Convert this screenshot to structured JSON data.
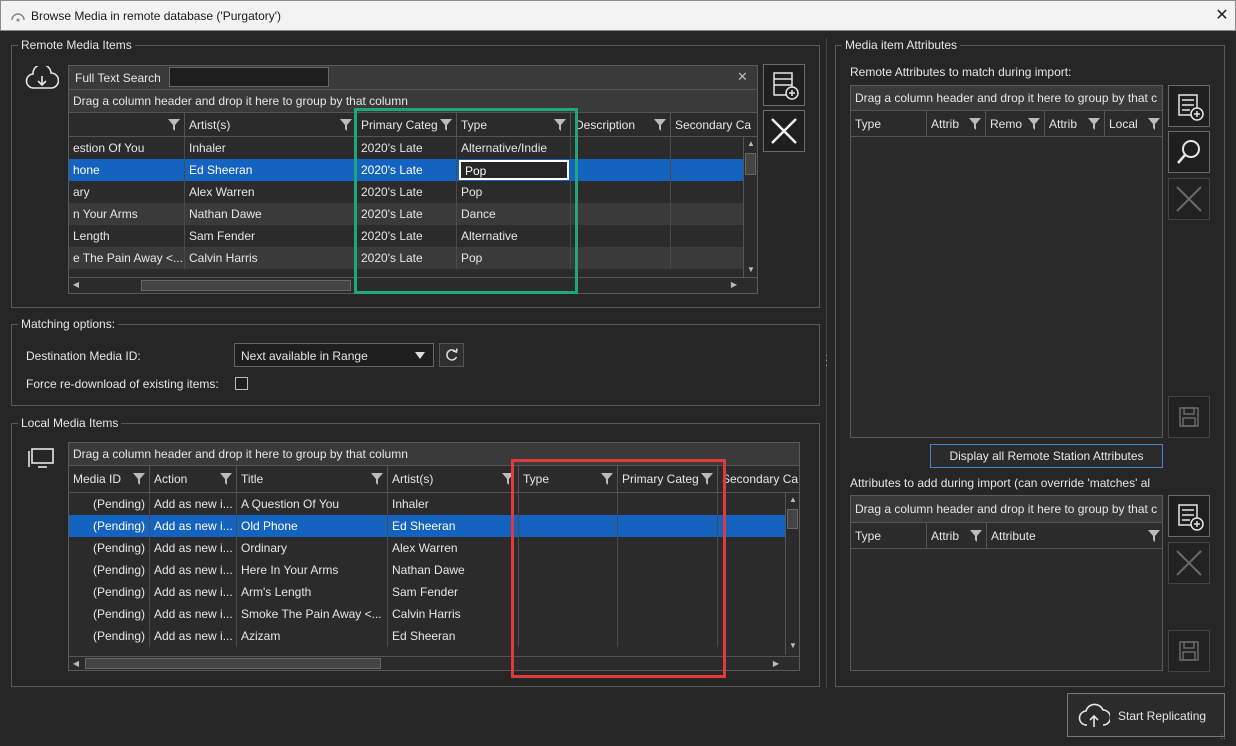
{
  "window": {
    "title": "Browse Media in remote database ('Purgatory')",
    "close_glyph": "✕"
  },
  "remote": {
    "group_label": "Remote Media Items",
    "search_label": "Full Text Search",
    "search_value": "",
    "clear_glyph": "✕",
    "group_hint": "Drag a column header and drop it here to group by that column",
    "columns": [
      "",
      "Artist(s)",
      "Primary Categ",
      "Type",
      "Description",
      "Secondary Ca"
    ],
    "rows": [
      {
        "title": "estion Of You",
        "artist": "Inhaler",
        "primary": "2020's Late",
        "type": "Alternative/Indie"
      },
      {
        "title": "hone",
        "artist": "Ed Sheeran",
        "primary": "2020's Late",
        "type": "Pop"
      },
      {
        "title": "ary",
        "artist": "Alex Warren",
        "primary": "2020's Late",
        "type": "Pop"
      },
      {
        "title": "n Your Arms",
        "artist": "Nathan Dawe",
        "primary": "2020's Late",
        "type": "Dance"
      },
      {
        "title": " Length",
        "artist": "Sam Fender",
        "primary": "2020's Late",
        "type": "Alternative"
      },
      {
        "title": "e The Pain Away <...",
        "artist": "Calvin Harris",
        "primary": "2020's Late",
        "type": "Pop"
      }
    ]
  },
  "matching": {
    "group_label": "Matching options:",
    "dest_label": "Destination Media ID:",
    "dest_value": "Next available in Range",
    "force_label": "Force re-download of existing items:"
  },
  "local": {
    "group_label": "Local Media Items",
    "group_hint": "Drag a column header and drop it here to group by that column",
    "columns": [
      "Media ID",
      "Action",
      "Title",
      "Artist(s)",
      "Type",
      "Primary Categ",
      "Secondary Ca"
    ],
    "rows": [
      {
        "id": "(Pending)",
        "action": "Add as new i...",
        "title": "A Question Of You",
        "artist": "Inhaler"
      },
      {
        "id": "(Pending)",
        "action": "Add as new i...",
        "title": "Old Phone",
        "artist": "Ed Sheeran"
      },
      {
        "id": "(Pending)",
        "action": "Add as new i...",
        "title": "Ordinary",
        "artist": "Alex Warren"
      },
      {
        "id": "(Pending)",
        "action": "Add as new i...",
        "title": "Here In Your Arms",
        "artist": "Nathan Dawe"
      },
      {
        "id": "(Pending)",
        "action": "Add as new i...",
        "title": "Arm's Length",
        "artist": "Sam Fender"
      },
      {
        "id": "(Pending)",
        "action": "Add as new i...",
        "title": "Smoke The Pain Away <...",
        "artist": "Calvin Harris"
      },
      {
        "id": "(Pending)",
        "action": "Add as new i...",
        "title": "Azizam",
        "artist": "Ed Sheeran"
      }
    ]
  },
  "attributes": {
    "group_label": "Media item Attributes",
    "remote_label": "Remote Attributes to match during import:",
    "remote_hint": "Drag a column header and drop it here to group by that c",
    "remote_columns": [
      "Type",
      "Attrib",
      "Remo",
      "Attrib",
      "Local"
    ],
    "display_all_label": "Display all Remote Station Attributes",
    "add_label": "Attributes to add during import (can override 'matches' al",
    "add_hint": "Drag a column header and drop it here to group by that c",
    "add_columns": [
      "Type",
      "Attrib",
      "Attribute"
    ]
  },
  "footer": {
    "start_label": "Start Replicating"
  },
  "colors": {
    "accent": "#1463c0",
    "highlight_green": "#21a67a",
    "highlight_red": "#e0393e"
  }
}
